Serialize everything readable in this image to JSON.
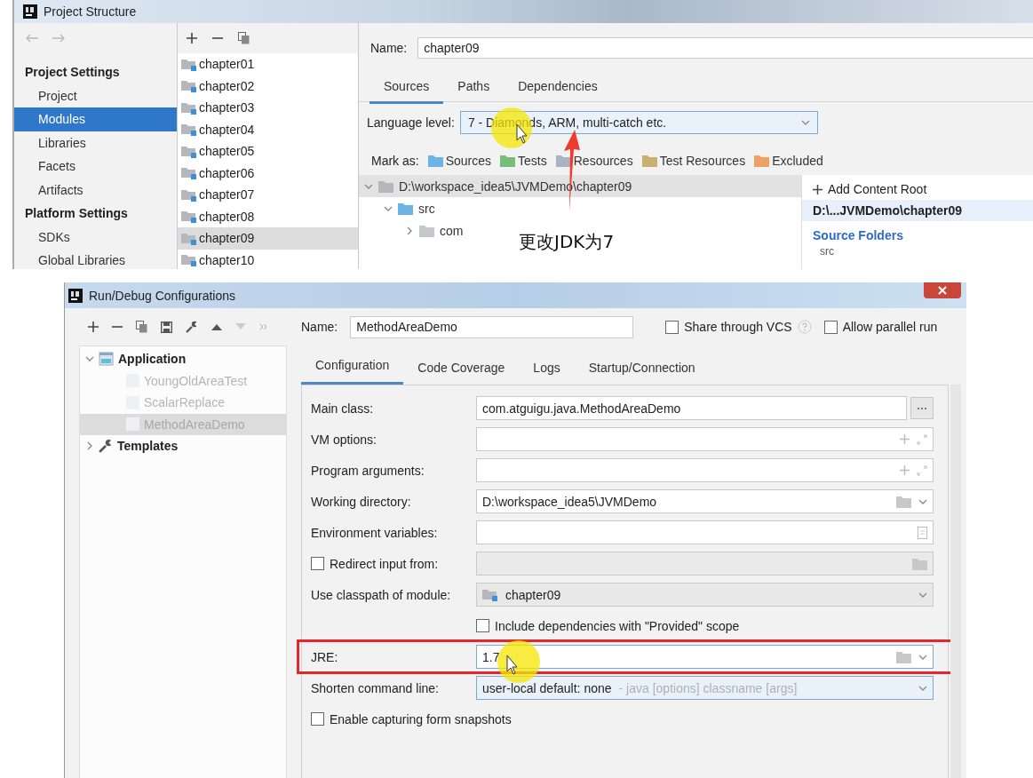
{
  "project_structure": {
    "window": {
      "title": "Project Structure"
    },
    "nav": [
      {
        "heading": "Project Settings",
        "items": [
          {
            "label": "Project",
            "selected": false
          },
          {
            "label": "Modules",
            "selected": true
          },
          {
            "label": "Libraries",
            "selected": false
          },
          {
            "label": "Facets",
            "selected": false
          },
          {
            "label": "Artifacts",
            "selected": false
          }
        ]
      },
      {
        "heading": "Platform Settings",
        "items": [
          {
            "label": "SDKs",
            "selected": false
          },
          {
            "label": "Global Libraries",
            "selected": false
          }
        ]
      }
    ],
    "modules": [
      {
        "name": "chapter01",
        "selected": false
      },
      {
        "name": "chapter02",
        "selected": false
      },
      {
        "name": "chapter03",
        "selected": false
      },
      {
        "name": "chapter04",
        "selected": false
      },
      {
        "name": "chapter05",
        "selected": false
      },
      {
        "name": "chapter06",
        "selected": false
      },
      {
        "name": "chapter07",
        "selected": false
      },
      {
        "name": "chapter08",
        "selected": false
      },
      {
        "name": "chapter09",
        "selected": true
      },
      {
        "name": "chapter10",
        "selected": false
      }
    ],
    "name": {
      "label": "Name:",
      "value": "chapter09"
    },
    "tabs": [
      {
        "label": "Sources",
        "selected": true
      },
      {
        "label": "Paths",
        "selected": false
      },
      {
        "label": "Dependencies",
        "selected": false
      }
    ],
    "language_level": {
      "label": "Language level:",
      "value": "7 - Diamonds, ARM, multi-catch etc."
    },
    "mark_as": {
      "label": "Mark as:",
      "buttons": [
        {
          "label": "Sources",
          "color": "#6cb4e4"
        },
        {
          "label": "Tests",
          "color": "#78be78"
        },
        {
          "label": "Resources",
          "color": "#a8b4c0"
        },
        {
          "label": "Test Resources",
          "color": "#c8b070"
        },
        {
          "label": "Excluded",
          "color": "#f0a060"
        }
      ]
    },
    "tree": {
      "label": "D:\\workspace_idea5\\JVMDemo\\chapter09",
      "expanded": true,
      "selected": true,
      "children": [
        {
          "label": "src",
          "expanded": true,
          "selected": false,
          "children": [
            {
              "label": "com",
              "expanded": false,
              "selected": false
            }
          ]
        }
      ]
    },
    "roots_panel": {
      "add_label": "Add Content Root",
      "root": "D:\\...JVMDemo\\chapter09",
      "section": "Source Folders",
      "folders": [
        "src"
      ]
    },
    "annotation": "更改JDK为7"
  },
  "run_debug": {
    "window": {
      "title": "Run/Debug Configurations"
    },
    "tree": [
      {
        "label": "Application",
        "kind": "application",
        "expanded": true,
        "children": [
          {
            "label": "YoungOldAreaTest",
            "selected": false
          },
          {
            "label": "ScalarReplace",
            "selected": false
          },
          {
            "label": "MethodAreaDemo",
            "selected": true
          }
        ]
      },
      {
        "label": "Templates",
        "kind": "templates",
        "expanded": false
      }
    ],
    "name": {
      "label": "Name:",
      "value": "MethodAreaDemo"
    },
    "options": [
      {
        "label": "Share through VCS",
        "checked": false,
        "help": true
      },
      {
        "label": "Allow parallel run",
        "checked": false,
        "help": false
      }
    ],
    "tabs": [
      {
        "label": "Configuration",
        "selected": true
      },
      {
        "label": "Code Coverage",
        "selected": false
      },
      {
        "label": "Logs",
        "selected": false
      },
      {
        "label": "Startup/Connection",
        "selected": false
      }
    ],
    "fields": [
      {
        "kind": "browse",
        "label": "Main class:",
        "value": "com.atguigu.java.MethodAreaDemo"
      },
      {
        "kind": "expandable",
        "label": "VM options:"
      },
      {
        "kind": "expandable",
        "label": "Program arguments:"
      },
      {
        "kind": "path",
        "label": "Working directory:",
        "value": "D:\\workspace_idea5\\JVMDemo"
      },
      {
        "kind": "env",
        "label": "Environment variables:"
      },
      {
        "kind": "redirect",
        "label": "Redirect input from:",
        "checked": false,
        "disabled": true
      },
      {
        "kind": "module",
        "label": "Use classpath of module:",
        "value": "chapter09"
      },
      {
        "kind": "sub-option",
        "label": "Include dependencies with \"Provided\" scope",
        "checked": false
      },
      {
        "kind": "path",
        "label": "JRE:",
        "value": "1.7",
        "highlighted": true
      },
      {
        "kind": "dropdown",
        "label": "Shorten command line:",
        "value": "user-local default: none",
        "hint": "- java [options] classname [args]"
      },
      {
        "kind": "option",
        "label": "Enable capturing form snapshots",
        "checked": false
      }
    ]
  }
}
